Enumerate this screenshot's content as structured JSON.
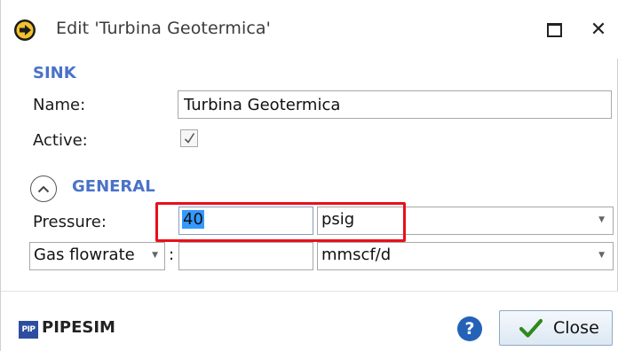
{
  "window": {
    "title": "Edit 'Turbina Geotermica'",
    "maximize_icon": "maximize-icon",
    "close_icon": "close-icon",
    "close_glyph": "✕"
  },
  "sink": {
    "section_label": "SINK",
    "name_label": "Name:",
    "name_value": "Turbina Geotermica",
    "active_label": "Active:",
    "active_checked": true
  },
  "general": {
    "section_label": "GENERAL",
    "collapse_icon": "chevron-up-icon",
    "pressure_label": "Pressure:",
    "pressure_value": "40",
    "pressure_unit": "psig",
    "flow_type": "Gas flowrate",
    "colon": ":",
    "flow_value": "",
    "flow_unit": "mmscf/d"
  },
  "footer": {
    "brand_icon_text": "PIP",
    "brand_name": "PIPESIM",
    "help_glyph": "?",
    "close_label": "Close"
  },
  "colors": {
    "accent": "#4a72c9",
    "highlight": "#e8101a",
    "selection": "#3399ff",
    "help": "#2462b8",
    "check": "#2f8a1e"
  }
}
